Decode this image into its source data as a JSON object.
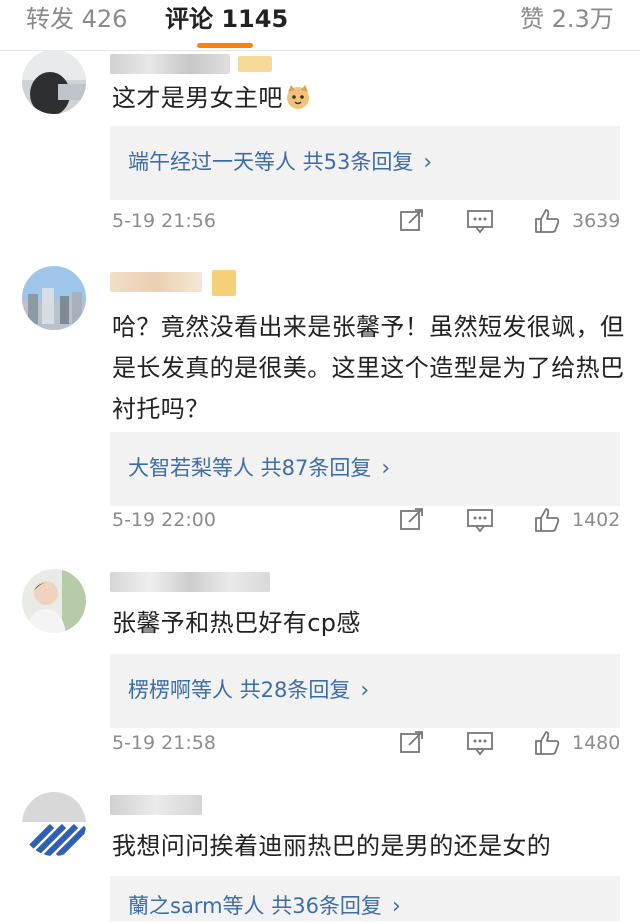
{
  "tabs": {
    "repost": "转发 426",
    "comments": "评论 1145",
    "likes": "赞 2.3万"
  },
  "comments": [
    {
      "text": "这才是男女主吧",
      "reply": "端午经过一天等人  共53条回复",
      "time": "5-19 21:56",
      "likes": "3639"
    },
    {
      "text": "哈？竟然没看出来是张馨予！虽然短发很飒，但是长发真的是很美。这里这个造型是为了给热巴衬托吗？",
      "reply": "大智若梨等人  共87条回复",
      "time": "5-19 22:00",
      "likes": "1402"
    },
    {
      "text": "张馨予和热巴好有cp感",
      "reply": "楞楞啊等人  共28条回复",
      "time": "5-19 21:58",
      "likes": "1480"
    },
    {
      "text": "我想问问挨着迪丽热巴的是男的还是女的",
      "reply": "蘭之sarm等人  共36条回复"
    }
  ],
  "colors": {
    "accent": "#ff8200",
    "reply_link": "#3d6da8",
    "muted": "#8c8c8c"
  }
}
